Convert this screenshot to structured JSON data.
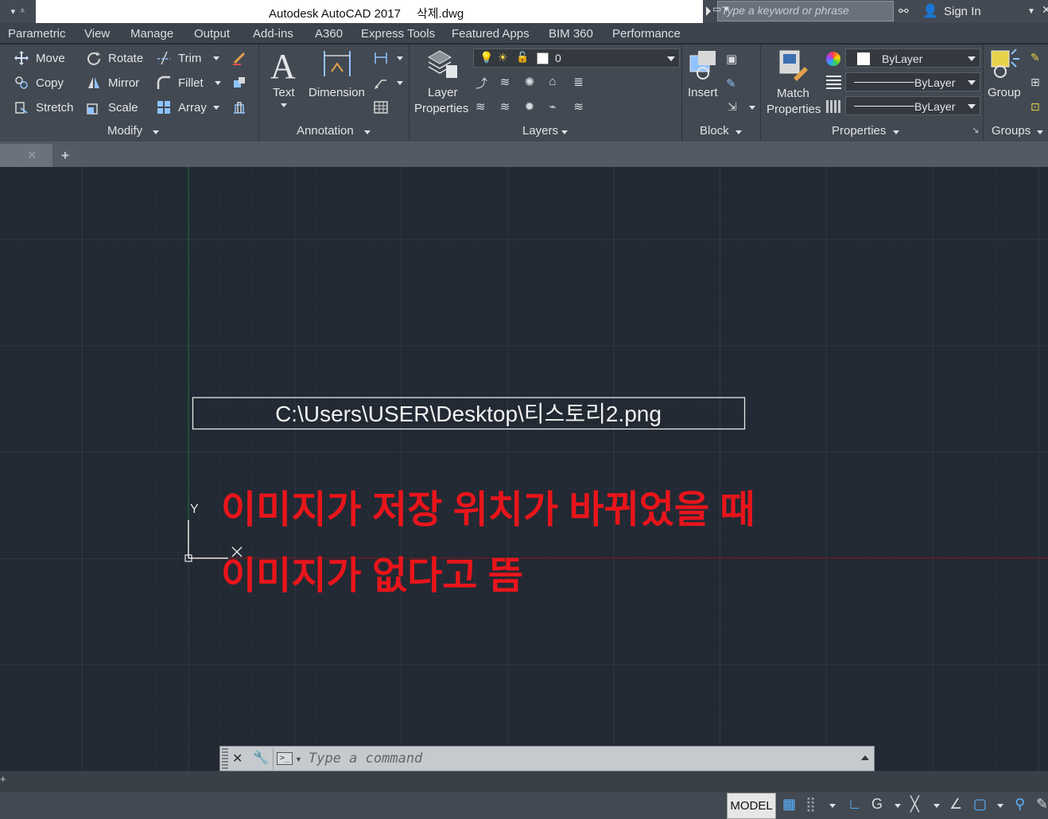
{
  "titlebar": {
    "app_title": "Autodesk AutoCAD 2017",
    "file_name": "삭제.dwg",
    "search_placeholder": "Type a keyword or phrase",
    "sign_in": "Sign In"
  },
  "ribbon_tabs": [
    "Parametric",
    "View",
    "Manage",
    "Output",
    "Add-ins",
    "A360",
    "Express Tools",
    "Featured Apps",
    "BIM 360",
    "Performance"
  ],
  "modify": {
    "title": "Modify",
    "move": "Move",
    "rotate": "Rotate",
    "trim": "Trim",
    "copy": "Copy",
    "mirror": "Mirror",
    "fillet": "Fillet",
    "stretch": "Stretch",
    "scale": "Scale",
    "array": "Array"
  },
  "annotation": {
    "title": "Annotation",
    "text": "Text",
    "dimension": "Dimension"
  },
  "layers": {
    "title": "Layers",
    "layer_properties_1": "Layer",
    "layer_properties_2": "Properties",
    "current_layer": "0"
  },
  "block": {
    "title": "Block",
    "insert": "Insert"
  },
  "properties": {
    "title": "Properties",
    "match_1": "Match",
    "match_2": "Properties",
    "color": "ByLayer",
    "linetype": "ByLayer",
    "lineweight": "ByLayer"
  },
  "groups": {
    "title": "Groups",
    "group": "Group"
  },
  "canvas": {
    "image_path": "C:\\Users\\USER\\Desktop\\티스토리2.png",
    "ucs_y": "Y",
    "annotation_line1": "이미지가 저장 위치가 바뀌었을 때",
    "annotation_line2": "이미지가 없다고 뜸",
    "annotation_color": "#e8151b"
  },
  "command_line": {
    "placeholder": "Type  a  command"
  },
  "status": {
    "model": "MODEL"
  }
}
